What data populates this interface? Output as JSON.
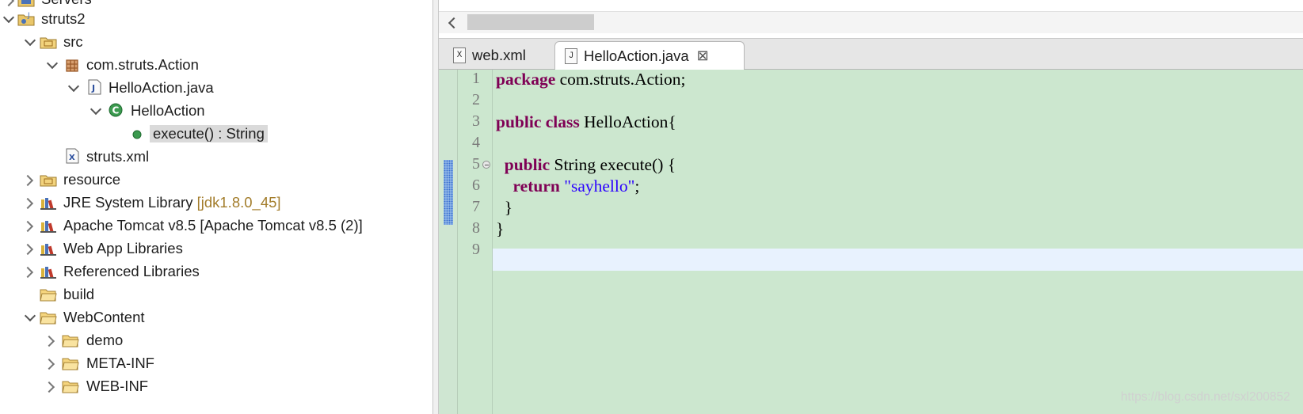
{
  "explorer": {
    "rows": [
      {
        "label": "Servers",
        "icon": "server-folder-icon"
      },
      {
        "label": "struts2",
        "icon": "project-icon"
      },
      {
        "label": "src",
        "icon": "source-folder-icon"
      },
      {
        "label": "com.struts.Action",
        "icon": "package-icon"
      },
      {
        "label": "HelloAction.java",
        "icon": "java-file-icon"
      },
      {
        "label": "HelloAction",
        "icon": "class-icon"
      },
      {
        "label": "execute() : String",
        "icon": "public-method-icon"
      },
      {
        "label": "struts.xml",
        "icon": "xml-file-icon"
      },
      {
        "label": "resource",
        "icon": "source-folder-icon"
      },
      {
        "label": "JRE System Library",
        "decoration": "[jdk1.8.0_45]",
        "icon": "library-icon"
      },
      {
        "label": "Apache Tomcat v8.5 [Apache Tomcat v8.5 (2)]",
        "icon": "library-icon"
      },
      {
        "label": "Web App Libraries",
        "icon": "library-icon"
      },
      {
        "label": "Referenced Libraries",
        "icon": "library-icon"
      },
      {
        "label": "build",
        "icon": "folder-icon"
      },
      {
        "label": "WebContent",
        "icon": "folder-icon"
      },
      {
        "label": "demo",
        "icon": "folder-icon"
      },
      {
        "label": "META-INF",
        "icon": "folder-icon"
      },
      {
        "label": "WEB-INF",
        "icon": "folder-icon"
      }
    ]
  },
  "tabs": [
    {
      "label": "web.xml",
      "icon": "xml-file-icon",
      "glyph": "X"
    },
    {
      "label": "HelloAction.java",
      "icon": "java-file-icon",
      "glyph": "J",
      "close": "⊠"
    }
  ],
  "editor": {
    "line_numbers": [
      "1",
      "2",
      "3",
      "4",
      "5",
      "6",
      "7",
      "8",
      "9"
    ],
    "code": {
      "l1_kw": "package",
      "l1_rest": " com.struts.Action;",
      "l3_kw1": "public",
      "l3_kw2": "class",
      "l3_rest": " HelloAction{",
      "l5_kw": "public",
      "l5_rest": " String execute() {",
      "l6_kw": "return",
      "l6_str": "\"sayhello\"",
      "l6_end": ";",
      "l7": "}",
      "l8": "}"
    }
  },
  "watermark": "https://blog.csdn.net/sxl200852",
  "colors": {
    "editor_bg": "#cce7cf",
    "keyword": "#7f0055",
    "string": "#2a00ff",
    "current_line": "#e8f2fe"
  }
}
